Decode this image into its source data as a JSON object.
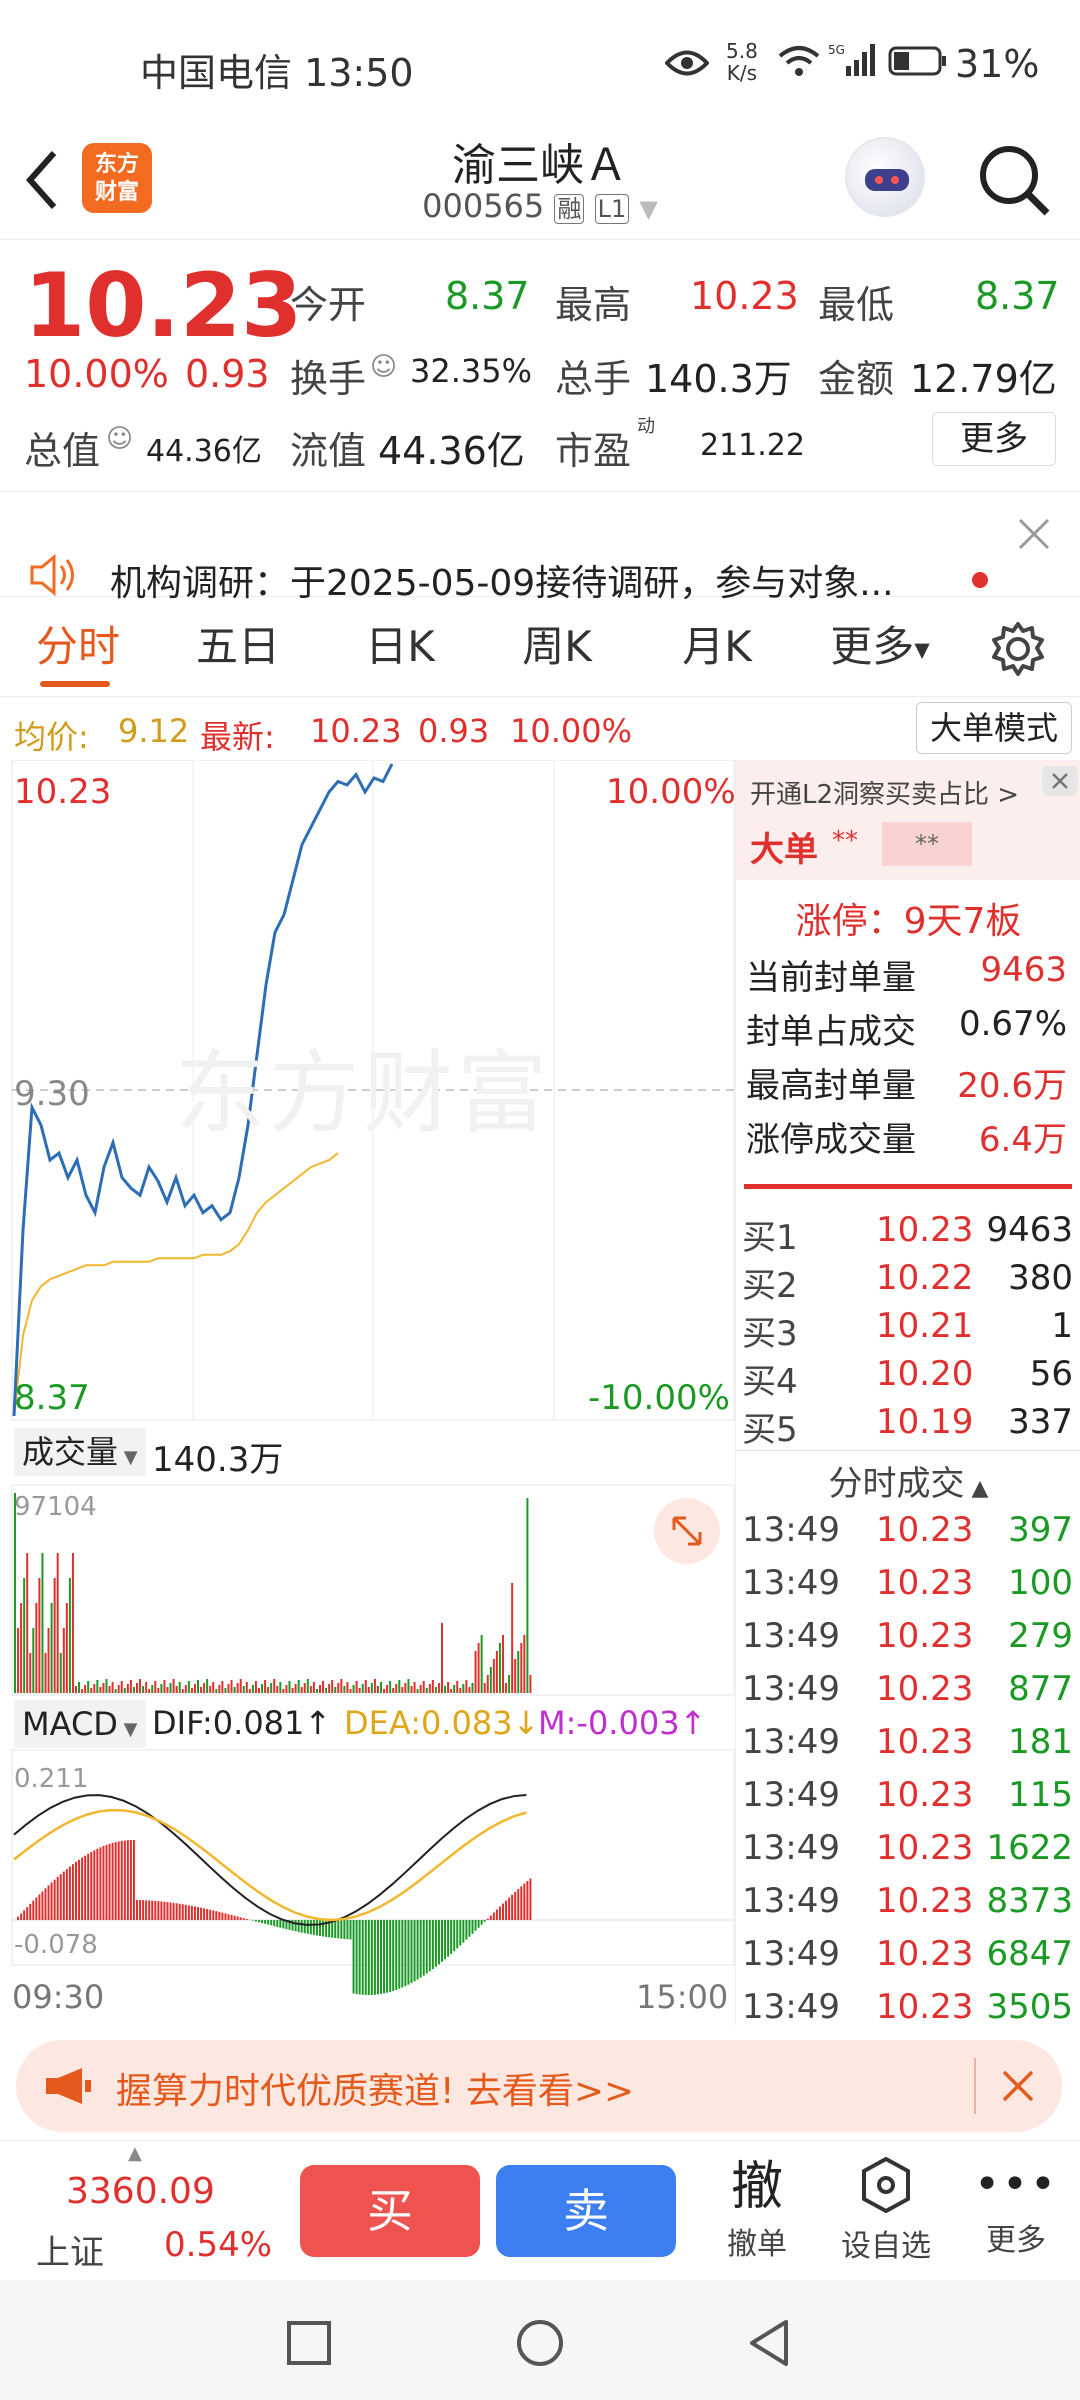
{
  "status": {
    "carrier_time": "中国电信 13:50",
    "speed_top": "5.8",
    "speed_bottom": "K/s",
    "battery": "31%"
  },
  "header": {
    "title": "渝三峡Ａ",
    "code": "000565",
    "rong": "融",
    "level": "L1",
    "logo_top": "东方",
    "logo_bottom": "财富"
  },
  "quote": {
    "price": "10.23",
    "pct": "10.00%",
    "change": "0.93",
    "open_label": "今开",
    "open": "8.37",
    "high_label": "最高",
    "high": "10.23",
    "low_label": "最低",
    "low": "8.37",
    "turnover_label": "换手",
    "turnover": "32.35%",
    "vol_label": "总手",
    "vol": "140.3万",
    "amount_label": "金额",
    "amount": "12.79亿",
    "mcap_label": "总值",
    "mcap": "44.36亿",
    "float_label": "流值",
    "float": "44.36亿",
    "pe_label": "市盈",
    "pe_sup": "动",
    "pe": "211.22",
    "more": "更多"
  },
  "notice": {
    "text": "机构调研：于2025-05-09接待调研，参与对象..."
  },
  "tabs": [
    "分时",
    "五日",
    "日K",
    "周K",
    "月K",
    "更多"
  ],
  "avg": {
    "label": "均价:",
    "value": "9.12",
    "latest_label": "最新:",
    "latest": "10.23",
    "change": "0.93",
    "pct": "10.00%",
    "mode_btn": "大单模式"
  },
  "chart": {
    "price_top": "10.23",
    "pct_top": "10.00%",
    "price_mid": "9.30",
    "price_bottom": "8.37",
    "pct_bottom": "-10.00%",
    "watermark": "东方财富",
    "vol_label": "成交量",
    "vol_value": "140.3万",
    "vol_max": "97104",
    "macd_label": "MACD",
    "dif": "DIF:0.081↑",
    "dea": "DEA:0.083↓",
    "m": "M:-0.003↑",
    "macd_top": "0.211",
    "macd_bottom": "-0.078",
    "time_start": "09:30",
    "time_end": "15:00",
    "price_series": [
      8.37,
      8.9,
      9.25,
      9.2,
      9.1,
      9.12,
      9.05,
      9.1,
      9.0,
      8.95,
      9.08,
      9.15,
      9.05,
      9.02,
      9.0,
      9.08,
      9.04,
      8.98,
      9.05,
      8.97,
      9.0,
      8.95,
      8.97,
      8.93,
      8.95,
      9.05,
      9.2,
      9.4,
      9.6,
      9.75,
      9.8,
      9.9,
      10.0,
      10.05,
      10.1,
      10.15,
      10.18,
      10.17,
      10.2,
      10.15,
      10.19,
      10.18,
      10.23
    ],
    "avg_series": [
      8.37,
      8.6,
      8.7,
      8.74,
      8.76,
      8.77,
      8.78,
      8.79,
      8.8,
      8.8,
      8.8,
      8.81,
      8.81,
      8.81,
      8.81,
      8.81,
      8.82,
      8.82,
      8.82,
      8.82,
      8.82,
      8.83,
      8.83,
      8.83,
      8.84,
      8.86,
      8.9,
      8.95,
      8.98,
      9.0,
      9.02,
      9.04,
      9.06,
      9.08,
      9.09,
      9.1,
      9.12
    ]
  },
  "side": {
    "l2_text": "开通L2洞察买卖占比 >",
    "big_label": "大单",
    "limit_title": "涨停：9天7板",
    "stats": [
      {
        "label": "当前封单量",
        "value": "9463"
      },
      {
        "label": "封单占成交",
        "value": "0.67%"
      },
      {
        "label": "最高封单量",
        "value": "20.6万"
      },
      {
        "label": "涨停成交量",
        "value": "6.4万"
      }
    ],
    "bids": [
      {
        "label": "买1",
        "price": "10.23",
        "vol": "9463"
      },
      {
        "label": "买2",
        "price": "10.22",
        "vol": "380"
      },
      {
        "label": "买3",
        "price": "10.21",
        "vol": "1"
      },
      {
        "label": "买4",
        "price": "10.20",
        "vol": "56"
      },
      {
        "label": "买5",
        "price": "10.19",
        "vol": "337"
      }
    ],
    "ticks_title": "分时成交",
    "ticks": [
      {
        "t": "13:49",
        "p": "10.23",
        "v": "397"
      },
      {
        "t": "13:49",
        "p": "10.23",
        "v": "100"
      },
      {
        "t": "13:49",
        "p": "10.23",
        "v": "279"
      },
      {
        "t": "13:49",
        "p": "10.23",
        "v": "877"
      },
      {
        "t": "13:49",
        "p": "10.23",
        "v": "181"
      },
      {
        "t": "13:49",
        "p": "10.23",
        "v": "115"
      },
      {
        "t": "13:49",
        "p": "10.23",
        "v": "1622"
      },
      {
        "t": "13:49",
        "p": "10.23",
        "v": "8373"
      },
      {
        "t": "13:49",
        "p": "10.23",
        "v": "6847"
      },
      {
        "t": "13:49",
        "p": "10.23",
        "v": "3505"
      }
    ]
  },
  "banner": {
    "text": "握算力时代优质赛道!  去看看>>"
  },
  "bottom": {
    "index_value": "3360.09",
    "index_name": "上证",
    "index_pct": "0.54%",
    "buy": "买",
    "sell": "卖",
    "cancel_char": "撤",
    "cancel": "撤单",
    "watch": "设自选",
    "more": "更多"
  }
}
